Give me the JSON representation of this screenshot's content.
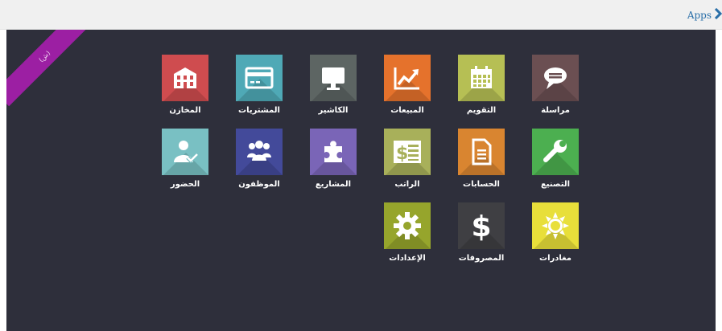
{
  "header": {
    "breadcrumb_label": "Apps"
  },
  "ribbon": {
    "text": "(ش)"
  },
  "apps": [
    {
      "label": "مراسلة",
      "color": "#6b4f52",
      "icon": "chat-bubble-icon"
    },
    {
      "label": "التقويم",
      "color": "#b6bf54",
      "icon": "calendar-icon"
    },
    {
      "label": "المبيعات",
      "color": "#e5722c",
      "icon": "chart-line-icon"
    },
    {
      "label": "الكاشير",
      "color": "#5d6563",
      "icon": "monitor-icon"
    },
    {
      "label": "المشتريات",
      "color": "#4fa9b6",
      "icon": "credit-card-icon"
    },
    {
      "label": "المخازن",
      "color": "#cf4c4f",
      "icon": "warehouse-icon"
    },
    {
      "label": "التصنيع",
      "color": "#4caf50",
      "icon": "wrench-icon"
    },
    {
      "label": "الحسابات",
      "color": "#d98530",
      "icon": "document-icon"
    },
    {
      "label": "الراتب",
      "color": "#a8b05a",
      "icon": "payslip-icon"
    },
    {
      "label": "المشاريع",
      "color": "#7a65b7",
      "icon": "puzzle-icon"
    },
    {
      "label": "الموظفون",
      "color": "#434a9a",
      "icon": "group-users-icon"
    },
    {
      "label": "الحضور",
      "color": "#79c0c3",
      "icon": "user-check-icon"
    },
    {
      "label": "مغادرات",
      "color": "#e8df3a",
      "icon": "sun-icon"
    },
    {
      "label": "المصروفات",
      "color": "#3f3f43",
      "icon": "dollar-icon"
    },
    {
      "label": "الإعدادات",
      "color": "#96a52c",
      "icon": "gear-icon"
    }
  ]
}
